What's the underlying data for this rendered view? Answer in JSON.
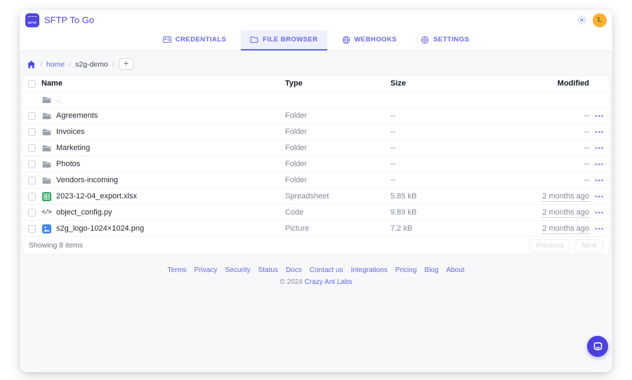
{
  "app": {
    "title": "SFTP To Go",
    "logo_text": "SFTP"
  },
  "header": {
    "avatar_initial": "L"
  },
  "tabs": [
    {
      "label": "CREDENTIALS",
      "icon": "id-card-icon",
      "active": false
    },
    {
      "label": "FILE BROWSER",
      "icon": "folder-icon",
      "active": true
    },
    {
      "label": "WEBHOOKS",
      "icon": "globe-icon",
      "active": false
    },
    {
      "label": "SETTINGS",
      "icon": "gear-icon",
      "active": false
    }
  ],
  "breadcrumb": {
    "root": "home",
    "current": "s2g-demo",
    "add_button": "+"
  },
  "table": {
    "columns": {
      "name": "Name",
      "type": "Type",
      "size": "Size",
      "modified": "Modified"
    },
    "rows": [
      {
        "name": "..",
        "icon": "folder",
        "type": "",
        "size": "",
        "modified": "",
        "checkbox": false,
        "actions": false
      },
      {
        "name": "Agreements",
        "icon": "folder",
        "type": "Folder",
        "size": "--",
        "modified": "--",
        "checkbox": true,
        "actions": true
      },
      {
        "name": "Invoices",
        "icon": "folder",
        "type": "Folder",
        "size": "--",
        "modified": "--",
        "checkbox": true,
        "actions": true
      },
      {
        "name": "Marketing",
        "icon": "folder",
        "type": "Folder",
        "size": "--",
        "modified": "--",
        "checkbox": true,
        "actions": true
      },
      {
        "name": "Photos",
        "icon": "folder",
        "type": "Folder",
        "size": "--",
        "modified": "--",
        "checkbox": true,
        "actions": true
      },
      {
        "name": "Vendors-incoming",
        "icon": "folder",
        "type": "Folder",
        "size": "--",
        "modified": "--",
        "checkbox": true,
        "actions": true
      },
      {
        "name": "2023-12-04_export.xlsx",
        "icon": "spreadsheet",
        "type": "Spreadsheet",
        "size": "5.85 kB",
        "modified": "2 months ago",
        "checkbox": true,
        "actions": true
      },
      {
        "name": "object_config.py",
        "icon": "code",
        "type": "Code",
        "size": "9.89 kB",
        "modified": "2 months ago",
        "checkbox": true,
        "actions": true
      },
      {
        "name": "s2g_logo-1024×1024.png",
        "icon": "picture",
        "type": "Picture",
        "size": "7.2 kB",
        "modified": "2 months ago",
        "checkbox": true,
        "actions": true
      }
    ],
    "summary": "Showing 8 items",
    "pagination": {
      "previous": "Previous",
      "next": "Next"
    }
  },
  "footer": {
    "links": [
      "Terms",
      "Privacy",
      "Security",
      "Status",
      "Docs",
      "Contact us",
      "Integrations",
      "Pricing",
      "Blog",
      "About"
    ],
    "copyright": "© 2024",
    "brand": "Crazy Ant Labs"
  },
  "colors": {
    "accent": "#4f46e5",
    "tab_text": "#6366f1",
    "active_tab_bg": "#eef0fe",
    "avatar_bg": "#f9b234",
    "folder_icon": "#9aa1ab",
    "spreadsheet_icon": "#2fa860",
    "picture_icon": "#4285f4",
    "chat_button": "#4b41e0"
  }
}
